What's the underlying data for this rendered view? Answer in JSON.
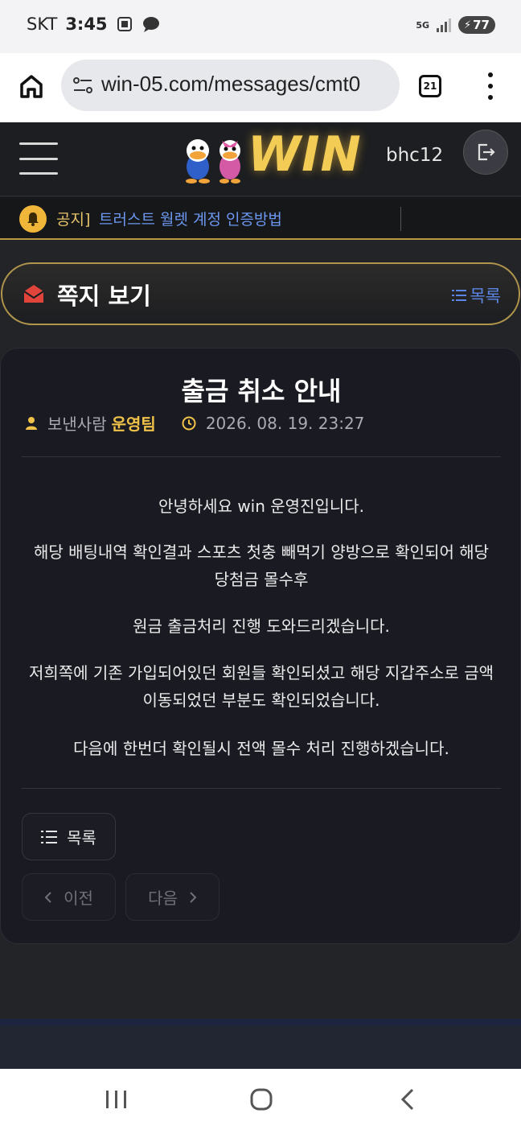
{
  "status_bar": {
    "carrier": "SKT",
    "time": "3:45",
    "network": "5G",
    "battery": "77"
  },
  "browser": {
    "url": "win-05.com/messages/cmt0",
    "tab_count": "21"
  },
  "header": {
    "logo_text": "WIN",
    "username": "bhc12"
  },
  "notice": {
    "prefix": "공지]",
    "text": "트러스트 월렛 계정 인증방법"
  },
  "page": {
    "title": "쪽지 보기",
    "list_link": "목록"
  },
  "message": {
    "subject": "출금 취소 안내",
    "sender_label": "보낸사람",
    "sender_name": "운영팀",
    "datetime": "2026. 08. 19. 23:27",
    "paragraphs": [
      "안녕하세요 win 운영진입니다.",
      "해당 배팅내역 확인결과 스포츠 첫충 빼먹기 양방으로 확인되어 해당 당첨금 몰수후",
      "원금 출금처리 진행 도와드리겠습니다.",
      "저희쪽에 기존 가입되어있던 회원들 확인되셨고 해당 지갑주소로 금액 이동되었던 부분도 확인되었습니다.",
      "다음에 한번더 확인될시 전액 몰수 처리 진행하겠습니다."
    ]
  },
  "buttons": {
    "list": "목록",
    "prev": "이전",
    "next": "다음"
  },
  "colors": {
    "accent_gold": "#f1c24a",
    "link_blue": "#5b86e6",
    "background": "#232428"
  }
}
